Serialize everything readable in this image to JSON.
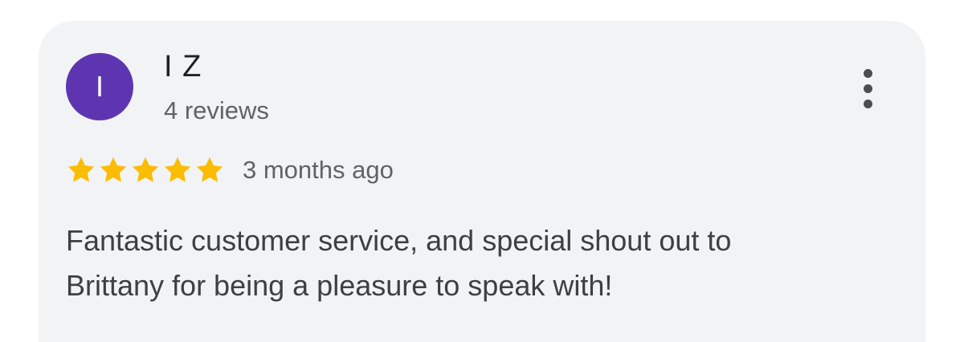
{
  "review": {
    "reviewer": {
      "initial": "I",
      "name": "I Z",
      "review_count": "4 reviews",
      "avatar_color": "#5e35b1"
    },
    "rating": 5,
    "rating_max": 5,
    "star_color": "#fbbc04",
    "date": "3 months ago",
    "text_lines": [
      "Fantastic customer service, and special shout out to",
      "Brittany for being a pleasure to speak with!"
    ],
    "menu_icon": "more-vert-icon"
  }
}
